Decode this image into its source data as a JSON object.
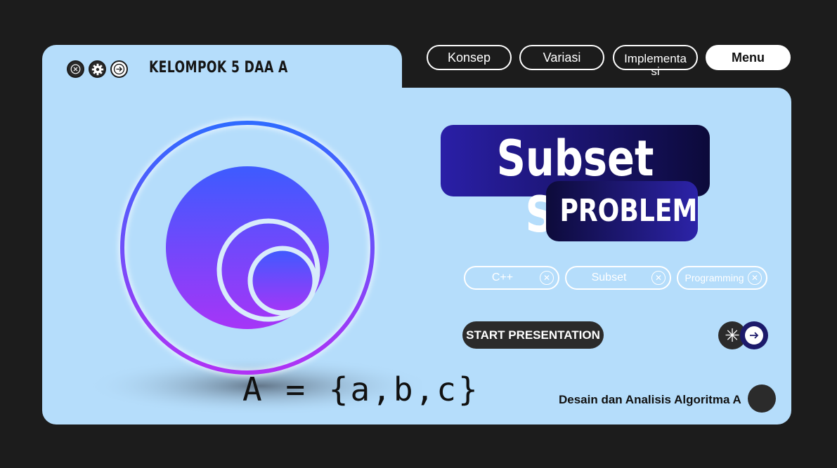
{
  "header": {
    "brand": "KELOMPOK 5 DAA A",
    "window_icons": [
      "close-icon",
      "gear-icon",
      "arrow-right-icon"
    ]
  },
  "nav": {
    "konsep": "Konsep",
    "variasi": "Variasi",
    "implementasi": "Implementa si",
    "menu": "Menu"
  },
  "hero": {
    "title": "Subset Sum",
    "subtitle": "PROBLEM"
  },
  "tags": [
    {
      "label": "C++"
    },
    {
      "label": "Subset"
    },
    {
      "label": "Programming"
    }
  ],
  "actions": {
    "start": "START PRESENTATION",
    "star_icon": "asterisk-icon",
    "next_icon": "arrow-right-icon"
  },
  "illustration": {
    "formula": "A = {a,b,c}",
    "colors": {
      "ring_top": "#2f6bff",
      "ring_bottom": "#b032f5",
      "disc_top": "#3d5bff",
      "disc_bottom": "#a635f7"
    }
  },
  "footer": {
    "text": "Desain dan Analisis Algoritma A"
  },
  "colors": {
    "background": "#1c1c1c",
    "card": "#b5ddfb",
    "title_dark": "#0c0a3a",
    "title_blue": "#2a1fa7"
  }
}
